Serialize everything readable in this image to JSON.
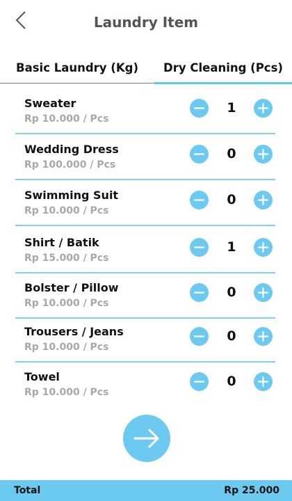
{
  "header": {
    "title": "Laundry Item"
  },
  "tabs": [
    {
      "label": "Basic Laundry (Kg)",
      "active": false
    },
    {
      "label": "Dry Cleaning (Pcs)",
      "active": true
    }
  ],
  "items": [
    {
      "name": "Sweater",
      "price": "Rp 10.000 / Pcs",
      "qty": "1"
    },
    {
      "name": "Wedding Dress",
      "price": "Rp 100.000 / Pcs",
      "qty": "0"
    },
    {
      "name": "Swimming Suit",
      "price": "Rp 10.000 / Pcs",
      "qty": "0"
    },
    {
      "name": "Shirt / Batik",
      "price": "Rp 15.000 / Pcs",
      "qty": "1"
    },
    {
      "name": "Bolster / Pillow",
      "price": "Rp 10.000 / Pcs",
      "qty": "0"
    },
    {
      "name": "Trousers / Jeans",
      "price": "Rp 10.000 / Pcs",
      "qty": "0"
    },
    {
      "name": "Towel",
      "price": "Rp 10.000 / Pcs",
      "qty": "0"
    }
  ],
  "footer": {
    "total_label": "Total",
    "total_value": "Rp 25.000"
  },
  "colors": {
    "accent": "#6ccaf1",
    "title": "#5a5150",
    "price": "#a8a8a8"
  },
  "icons": {
    "back": "chevron-left-icon",
    "minus": "minus-icon",
    "plus": "plus-icon",
    "next": "arrow-right-icon"
  }
}
